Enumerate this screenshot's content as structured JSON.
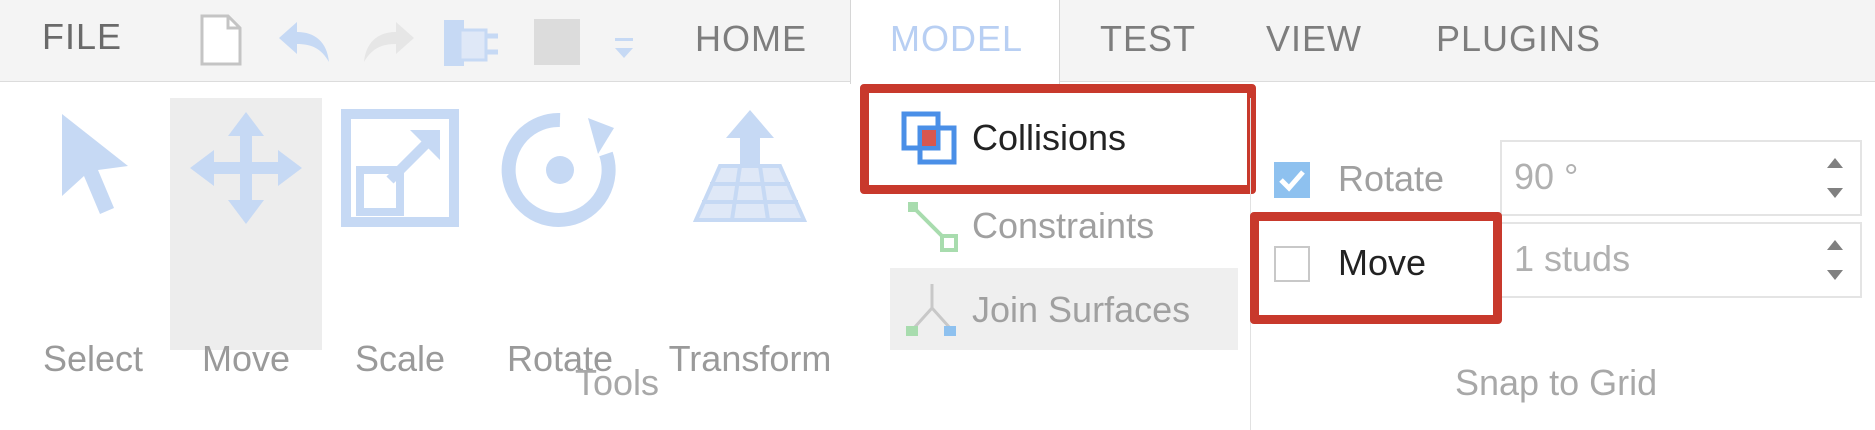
{
  "menu": {
    "file": "FILE"
  },
  "tabs": [
    {
      "label": "HOME"
    },
    {
      "label": "MODEL",
      "active": true
    },
    {
      "label": "TEST"
    },
    {
      "label": "VIEW"
    },
    {
      "label": "PLUGINS"
    }
  ],
  "quick_access_icons": [
    "new-file-icon",
    "undo-icon",
    "redo-icon",
    "publish-icon",
    "stop-icon",
    "customize-dropdown-icon"
  ],
  "tools": {
    "items": [
      {
        "label": "Select",
        "icon": "select-arrow-icon"
      },
      {
        "label": "Move",
        "icon": "move-icon",
        "selected": true
      },
      {
        "label": "Scale",
        "icon": "scale-icon"
      },
      {
        "label": "Rotate",
        "icon": "rotate-icon"
      },
      {
        "label": "Transform",
        "icon": "transform-icon"
      }
    ],
    "group_label": "Tools"
  },
  "collision_group": {
    "collisions": "Collisions",
    "constraints": "Constraints",
    "join_surfaces": "Join Surfaces"
  },
  "snap_to_grid": {
    "rotate_label": "Rotate",
    "rotate_checked": true,
    "rotate_value": "90 °",
    "move_label": "Move",
    "move_checked": false,
    "move_value": "1 studs",
    "group_label": "Snap to Grid"
  },
  "colors": {
    "highlight": "#c8392c",
    "accent_blue": "#b8cff3",
    "checkbox_blue": "#8ec1ef"
  }
}
